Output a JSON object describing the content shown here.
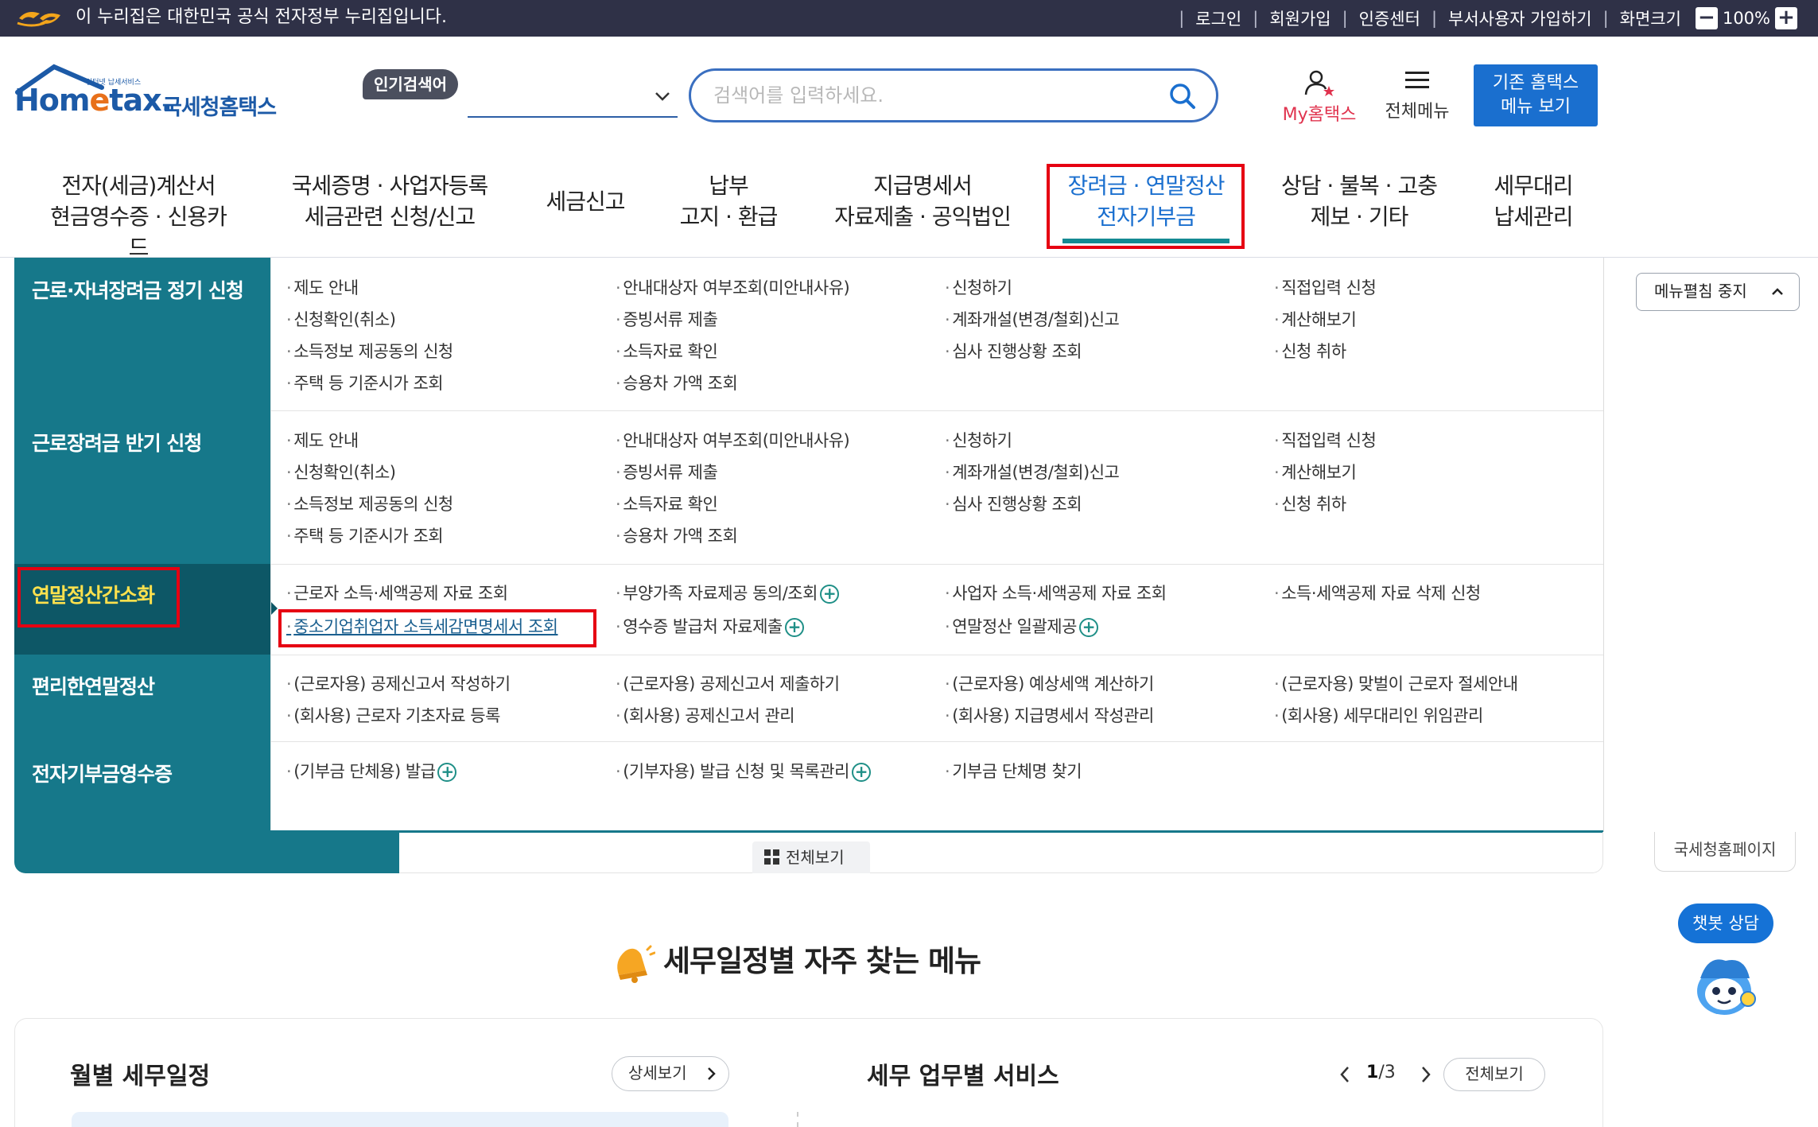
{
  "topbar": {
    "gov_notice": "이 누리집은 대한민국 공식 전자정부 누리집입니다.",
    "links": [
      "로그인",
      "회원가입",
      "인증센터",
      "부서사용자 가입하기",
      "화면크기"
    ],
    "zoom_minus": "−",
    "zoom_level": "100%",
    "zoom_plus": "+"
  },
  "header": {
    "logo_small": "인터넷 납세서비스",
    "logo_main_a": "Hom",
    "logo_main_e": "e",
    "logo_main_b": "tax.",
    "logo_kr": "국세청홈택스",
    "popular_label": "인기검색어",
    "search_placeholder": "검색어를 입력하세요.",
    "my_hometax": "My홈택스",
    "all_menu": "전체메뉴",
    "old_menu_line1": "기존 홈택스",
    "old_menu_line2": "메뉴 보기"
  },
  "gnb": [
    {
      "line1": "전자(세금)계산서",
      "line2": "현금영수증 · 신용카드"
    },
    {
      "line1": "국세증명 · 사업자등록",
      "line2": "세금관련 신청/신고"
    },
    {
      "line1": "세금신고",
      "line2": ""
    },
    {
      "line1": "납부",
      "line2": "고지 · 환급"
    },
    {
      "line1": "지급명세서",
      "line2": "자료제출 · 공익법인"
    },
    {
      "line1": "장려금 · 연말정산",
      "line2": "전자기부금"
    },
    {
      "line1": "상담 · 불복 · 고충",
      "line2": "제보 · 기타"
    },
    {
      "line1": "세무대리",
      "line2": "납세관리"
    }
  ],
  "mega": {
    "sections": [
      {
        "title": "근로·자녀장려금 정기 신청",
        "cols": [
          [
            "제도 안내",
            "신청확인(취소)",
            "소득정보 제공동의 신청",
            "주택 등 기준시가 조회"
          ],
          [
            "안내대상자 여부조회(미안내사유)",
            "증빙서류 제출",
            "소득자료 확인",
            "승용차 가액 조회"
          ],
          [
            "신청하기",
            "계좌개설(변경/철회)신고",
            "심사 진행상황 조회"
          ],
          [
            "직접입력 신청",
            "계산해보기",
            "신청 취하"
          ]
        ]
      },
      {
        "title": "근로장려금 반기 신청",
        "cols": [
          [
            "제도 안내",
            "신청확인(취소)",
            "소득정보 제공동의 신청",
            "주택 등 기준시가 조회"
          ],
          [
            "안내대상자 여부조회(미안내사유)",
            "증빙서류 제출",
            "소득자료 확인",
            "승용차 가액 조회"
          ],
          [
            "신청하기",
            "계좌개설(변경/철회)신고",
            "심사 진행상황 조회"
          ],
          [
            "직접입력 신청",
            "계산해보기",
            "신청 취하"
          ]
        ]
      },
      {
        "title": "연말정산간소화",
        "cols": [
          [
            "근로자 소득·세액공제 자료 조회",
            "중소기업취업자 소득세감면명세서 조회"
          ],
          [
            "부양가족 자료제공 동의/조회",
            "영수증 발급처 자료제출"
          ],
          [
            "사업자 소득·세액공제 자료 조회",
            "연말정산 일괄제공"
          ],
          [
            "소득·세액공제 자료 삭제 신청"
          ]
        ]
      },
      {
        "title": "편리한연말정산",
        "cols": [
          [
            "(근로자용) 공제신고서 작성하기",
            "(회사용) 근로자 기초자료 등록"
          ],
          [
            "(근로자용) 공제신고서 제출하기",
            "(회사용) 공제신고서 관리"
          ],
          [
            "(근로자용) 예상세액 계산하기",
            "(회사용) 지급명세서 작성관리"
          ],
          [
            "(근로자용) 맞벌이 근로자 절세안내",
            "(회사용) 세무대리인 위임관리"
          ]
        ]
      },
      {
        "title": "전자기부금영수증",
        "cols": [
          [
            "(기부금 단체용) 발급"
          ],
          [
            "(기부자용) 발급 신청 및 목록관리"
          ],
          [
            "기부금 단체명 찾기"
          ],
          []
        ]
      }
    ],
    "view_all": "전체보기",
    "menu_stop": "메뉴펼침 중지"
  },
  "side": {
    "nts_page": "국세청홈페이지",
    "chatbot": "챗봇 상담"
  },
  "main": {
    "section_title": "세무일정별 자주 찾는 메뉴",
    "monthly_title": "월별 세무일정",
    "detail_btn": "상세보기",
    "service_title": "세무 업무별 서비스",
    "page_current": "1",
    "page_total": "/3",
    "all_view_btn": "전체보기"
  },
  "colors": {
    "topbar": "#2f3147",
    "teal": "#16788a",
    "brand_blue": "#1a6fcf",
    "highlight_red": "#e60012",
    "active_yellow": "#ffe14d"
  }
}
